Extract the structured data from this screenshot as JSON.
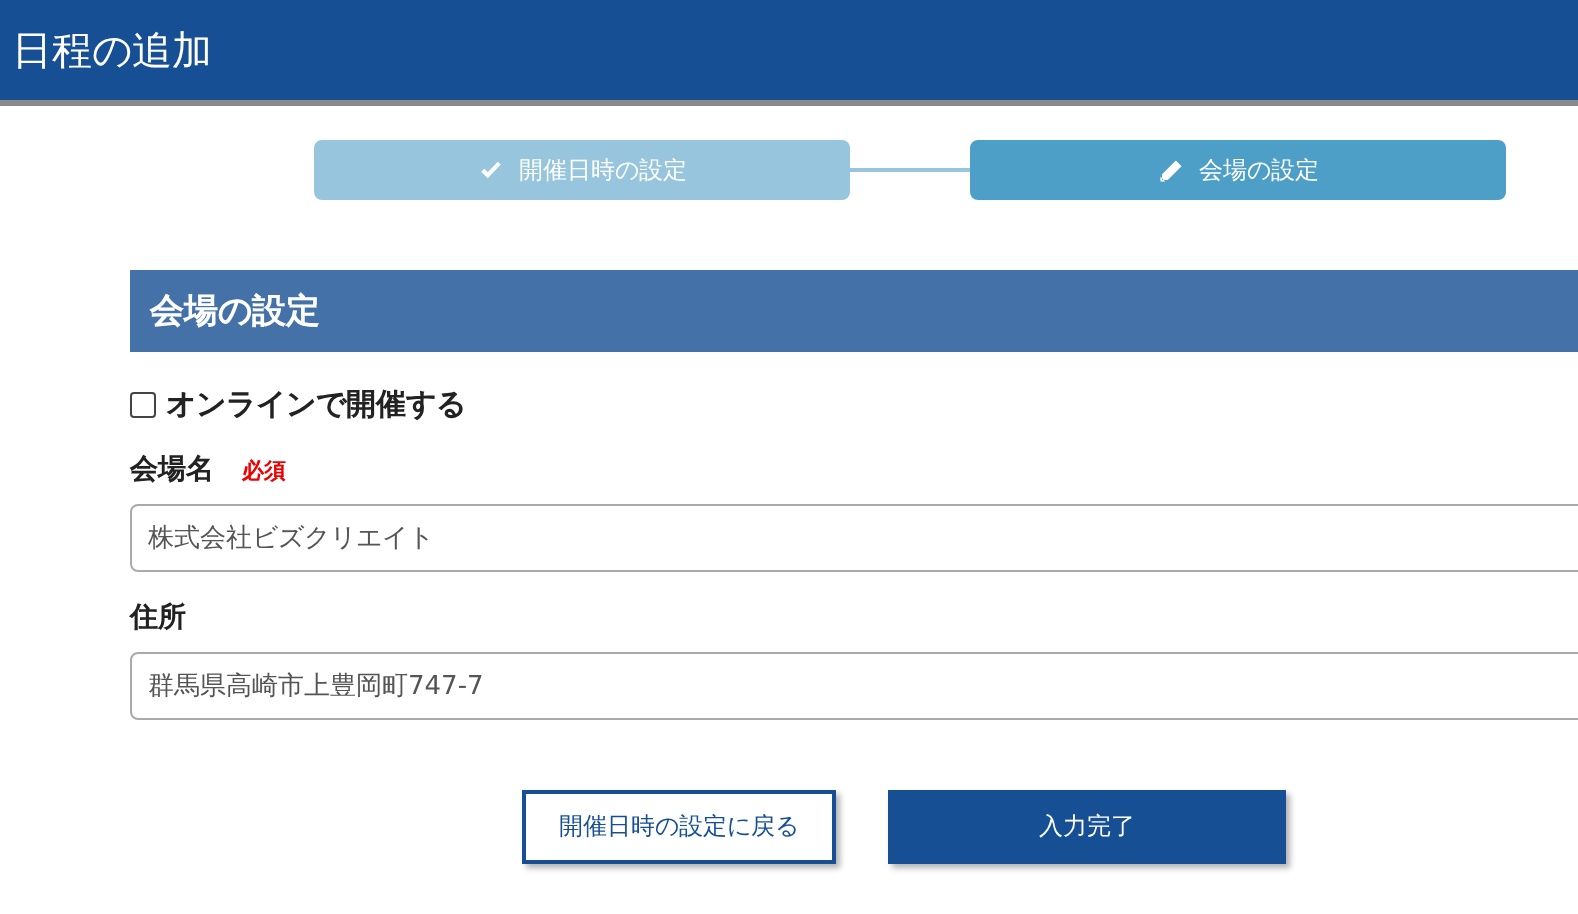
{
  "window": {
    "title": "日程の追加"
  },
  "steps": [
    {
      "label": "開催日時の設定",
      "kind": "check",
      "selected": false
    },
    {
      "label": "会場の設定",
      "kind": "edit",
      "selected": true
    }
  ],
  "section": {
    "title": "会場の設定"
  },
  "online": {
    "label": "オンラインで開催する",
    "checked": false
  },
  "fields": [
    {
      "label": "会場名",
      "required": "必須",
      "value": "株式会社ビズクリエイト"
    },
    {
      "label": "住所",
      "value": "群馬県高崎市上豊岡町747-7"
    }
  ],
  "buttons": [
    {
      "label": "開催日時の設定に戻る",
      "kind": "secondary"
    },
    {
      "label": "入力完了",
      "kind": "primary"
    }
  ]
}
